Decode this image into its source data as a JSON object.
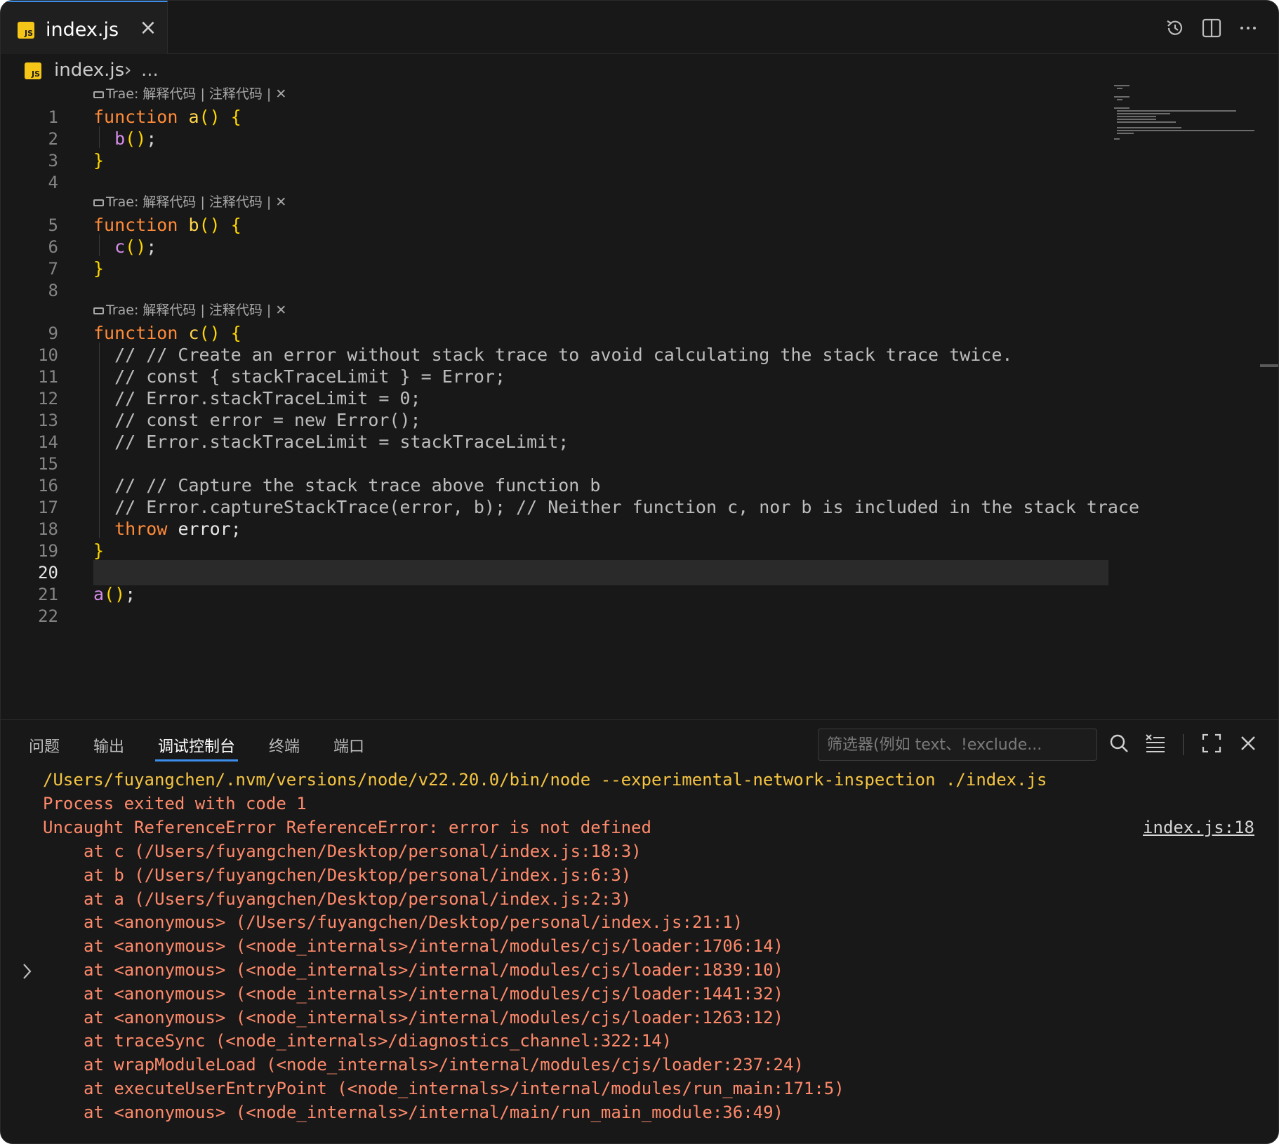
{
  "tab": {
    "label": "index.js",
    "lang_badge": "JS"
  },
  "breadcrumb": {
    "file": "index.js",
    "more": "..."
  },
  "codelens": {
    "text": "Trae: 解释代码 | 注释代码 | ✕"
  },
  "editor": {
    "active_line": "20",
    "lines": [
      {
        "n": "1",
        "t": "function a() {"
      },
      {
        "n": "2",
        "t": "  b();"
      },
      {
        "n": "3",
        "t": "}"
      },
      {
        "n": "4",
        "t": ""
      },
      {
        "n": "5",
        "t": "function b() {"
      },
      {
        "n": "6",
        "t": "  c();"
      },
      {
        "n": "7",
        "t": "}"
      },
      {
        "n": "8",
        "t": ""
      },
      {
        "n": "9",
        "t": "function c() {"
      },
      {
        "n": "10",
        "t": "  // // Create an error without stack trace to avoid calculating the stack trace twice."
      },
      {
        "n": "11",
        "t": "  // const { stackTraceLimit } = Error;"
      },
      {
        "n": "12",
        "t": "  // Error.stackTraceLimit = 0;"
      },
      {
        "n": "13",
        "t": "  // const error = new Error();"
      },
      {
        "n": "14",
        "t": "  // Error.stackTraceLimit = stackTraceLimit;"
      },
      {
        "n": "15",
        "t": ""
      },
      {
        "n": "16",
        "t": "  // // Capture the stack trace above function b"
      },
      {
        "n": "17",
        "t": "  // Error.captureStackTrace(error, b); // Neither function c, nor b is included in the stack trace"
      },
      {
        "n": "18",
        "t": "  throw error;"
      },
      {
        "n": "19",
        "t": "}"
      },
      {
        "n": "20",
        "t": ""
      },
      {
        "n": "21",
        "t": "a();"
      },
      {
        "n": "22",
        "t": ""
      }
    ]
  },
  "panel": {
    "tabs": [
      "问题",
      "输出",
      "调试控制台",
      "终端",
      "端口"
    ],
    "active_tab": "调试控制台",
    "filter_placeholder": "筛选器(例如 text、!exclude..."
  },
  "console": {
    "command": "/Users/fuyangchen/.nvm/versions/node/v22.20.0/bin/node --experimental-network-inspection ./index.js",
    "exit": "Process exited with code 1",
    "error": "Uncaught ReferenceError ReferenceError: error is not defined",
    "source_link": "index.js:18",
    "stack": [
      "at c (/Users/fuyangchen/Desktop/personal/index.js:18:3)",
      "at b (/Users/fuyangchen/Desktop/personal/index.js:6:3)",
      "at a (/Users/fuyangchen/Desktop/personal/index.js:2:3)",
      "at <anonymous> (/Users/fuyangchen/Desktop/personal/index.js:21:1)",
      "at <anonymous> (<node_internals>/internal/modules/cjs/loader:1706:14)",
      "at <anonymous> (<node_internals>/internal/modules/cjs/loader:1839:10)",
      "at <anonymous> (<node_internals>/internal/modules/cjs/loader:1441:32)",
      "at <anonymous> (<node_internals>/internal/modules/cjs/loader:1263:12)",
      "at traceSync (<node_internals>/diagnostics_channel:322:14)",
      "at wrapModuleLoad (<node_internals>/internal/modules/cjs/loader:237:24)",
      "at executeUserEntryPoint (<node_internals>/internal/modules/run_main:171:5)",
      "at <anonymous> (<node_internals>/internal/main/run_main_module:36:49)"
    ]
  },
  "colors": {
    "accent": "#3b8eea",
    "keyword": "#ff8b39",
    "function_name": "#ffd54a",
    "call": "#d48ce8",
    "console_warn": "#f5c542",
    "console_error": "#ff8a6b"
  },
  "icons": {
    "toolbar": [
      "history-icon",
      "split-editor-icon",
      "more-actions-icon"
    ],
    "panel": [
      "search-icon",
      "clear-console-icon",
      "maximize-panel-icon",
      "close-panel-icon"
    ]
  }
}
